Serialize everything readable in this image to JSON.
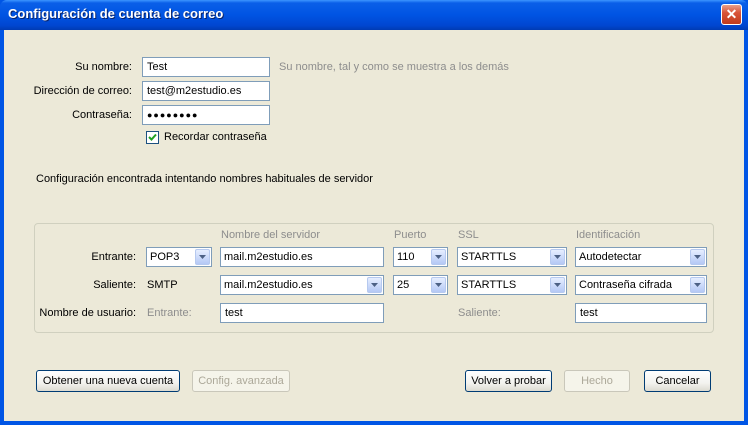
{
  "window": {
    "title": "Configuración de cuenta de correo",
    "close_glyph": "✕"
  },
  "form": {
    "name_label": "Su nombre:",
    "name_value": "Test",
    "name_hint": "Su nombre, tal y como se muestra a los demás",
    "email_label": "Dirección de correo:",
    "email_value": "test@m2estudio.es",
    "password_label": "Contraseña:",
    "password_value": "●●●●●●●●",
    "remember_label": "Recordar contraseña",
    "remember_checked": true
  },
  "status_message": "Configuración encontrada intentando nombres habituales de servidor",
  "server": {
    "headers": {
      "server_name": "Nombre del servidor",
      "port": "Puerto",
      "ssl": "SSL",
      "auth": "Identificación"
    },
    "incoming": {
      "label": "Entrante:",
      "protocol": "POP3",
      "host": "mail.m2estudio.es",
      "port": "110",
      "ssl": "STARTTLS",
      "auth": "Autodetectar"
    },
    "outgoing": {
      "label": "Saliente:",
      "protocol": "SMTP",
      "host": "mail.m2estudio.es",
      "port": "25",
      "ssl": "STARTTLS",
      "auth": "Contraseña cifrada"
    },
    "username": {
      "label": "Nombre de usuario:",
      "incoming_label": "Entrante:",
      "incoming_value": "test",
      "outgoing_label": "Saliente:",
      "outgoing_value": "test"
    }
  },
  "buttons": {
    "new_account": "Obtener una nueva cuenta",
    "advanced": "Config. avanzada",
    "retest": "Volver a probar",
    "done": "Hecho",
    "cancel": "Cancelar"
  }
}
